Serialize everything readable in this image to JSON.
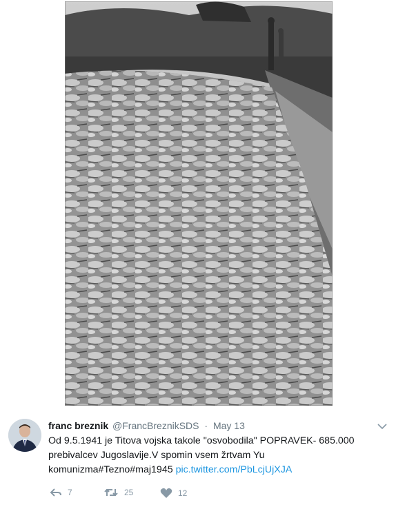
{
  "photo": {
    "icon": "photo-image"
  },
  "tweet": {
    "name": "franc breznik",
    "handle": "@FrancBreznikSDS",
    "separator": "·",
    "date": "May 13",
    "text_line1": "Od 9.5.1941 je Titova vojska takole \"osvobodila\" POPRAVEK- 685.000",
    "text_line2": "prebivalcev Jugoslavije.V spomin vsem žrtvam Yu",
    "text_line3": "komunizma#Tezno#maj1945",
    "link": "pic.twitter.com/PbLcjUjXJA",
    "replies": "7",
    "retweets": "25",
    "likes": "12"
  },
  "icons": {
    "avatar": "avatar-photo",
    "menu": "chevron-down-icon",
    "reply": "reply-icon",
    "retweet": "retweet-icon",
    "like": "heart-icon"
  },
  "colors": {
    "text": "#14171a",
    "muted": "#66757f",
    "link": "#1b95e0",
    "action": "#8899a6"
  }
}
